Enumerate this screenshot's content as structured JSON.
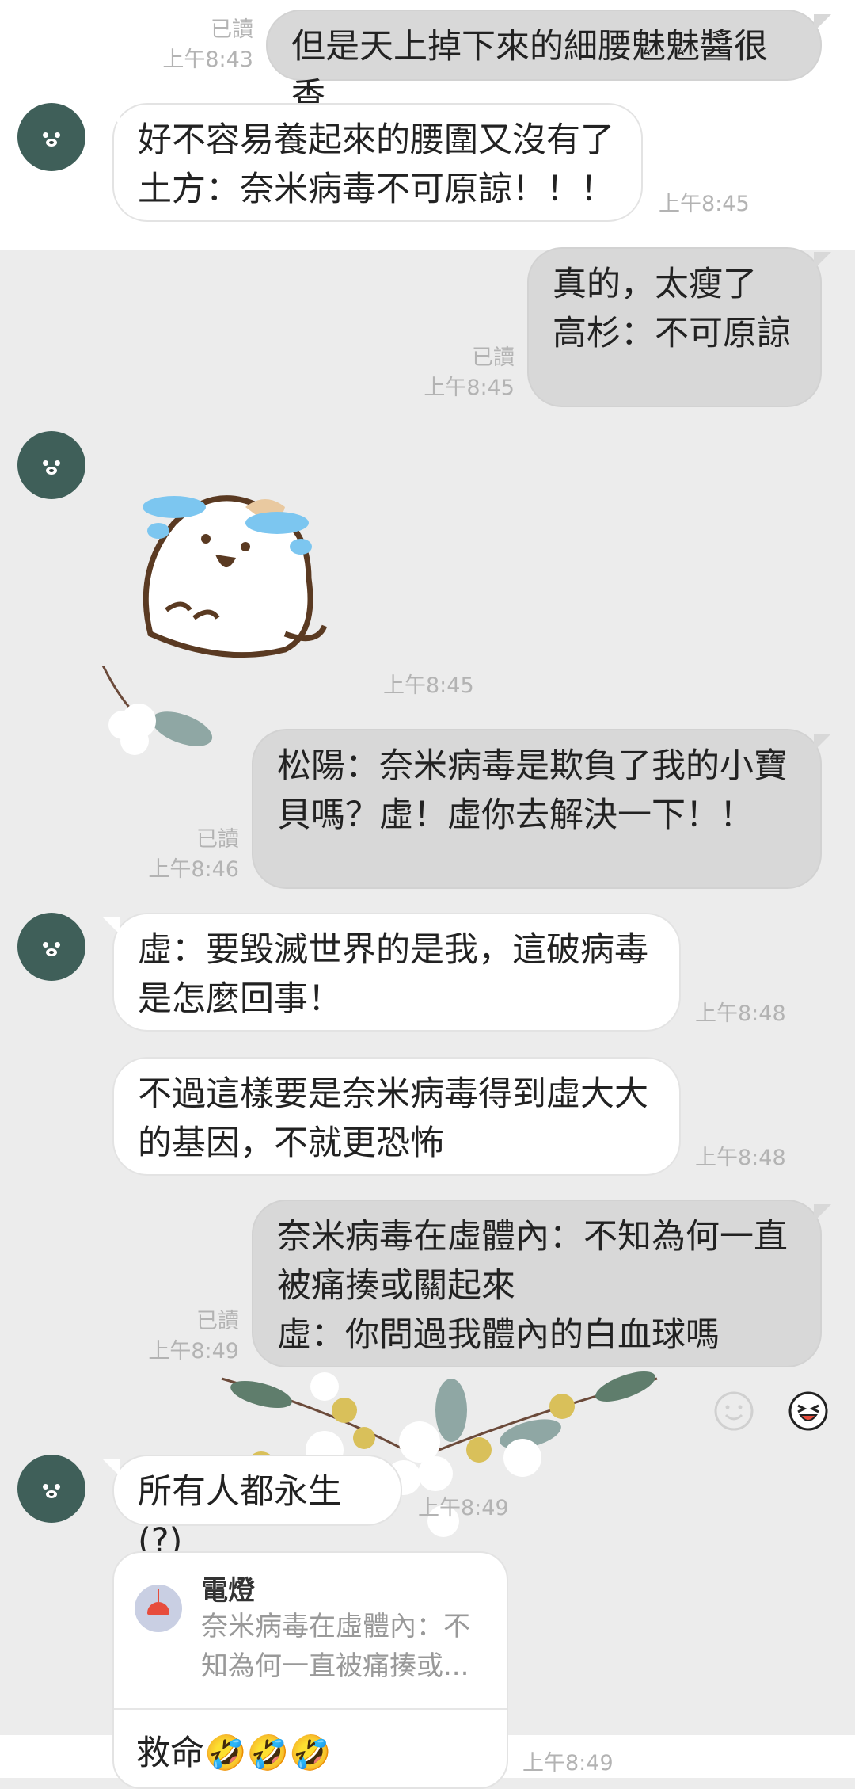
{
  "messages": {
    "m1": {
      "text": "但是天上掉下來的細腰魅魅醬很香",
      "read": "已讀",
      "time": "上午8:43"
    },
    "m2": {
      "text": "好不容易養起來的腰圍又沒有了\n土方：奈米病毒不可原諒！！！",
      "time": "上午8:45"
    },
    "m3": {
      "text": "真的，太瘦了\n高杉：不可原諒",
      "read": "已讀",
      "time": "上午8:45"
    },
    "m4": {
      "time": "上午8:45"
    },
    "m5": {
      "text": "松陽：奈米病毒是欺負了我的小寶\n貝嗎？虛！虛你去解決一下！！",
      "read": "已讀",
      "time": "上午8:46"
    },
    "m6": {
      "text": "虛：要毀滅世界的是我，這破病毒\n是怎麼回事！",
      "time": "上午8:48"
    },
    "m7": {
      "text": "不過這樣要是奈米病毒得到虛大大\n的基因，不就更恐怖",
      "time": "上午8:48"
    },
    "m8": {
      "text": "奈米病毒在虛體內：不知為何一直\n被痛揍或關起來\n虛：你問過我體內的白血球嗎",
      "read": "已讀",
      "time": "上午8:49"
    },
    "m9": {
      "text": "所有人都永生(?)",
      "time": "上午8:49"
    },
    "m10": {
      "reply_name": "電燈",
      "reply_quote": "奈米病毒在虛體內：不知為何一直被痛揍或...",
      "text": "救命🤣🤣🤣",
      "time": "上午8:49"
    }
  },
  "icons": {
    "avatar": "bear-avatar-icon",
    "sticker": "crying-cat-sticker",
    "reaction_smile": "smile-reaction-icon",
    "reaction_laugh": "laughing-face-icon"
  },
  "colors": {
    "incoming": "#ffffff",
    "outgoing": "#d8d8d8",
    "avatar": "#3f5f59",
    "accent_lamp": "#e74c3c"
  }
}
